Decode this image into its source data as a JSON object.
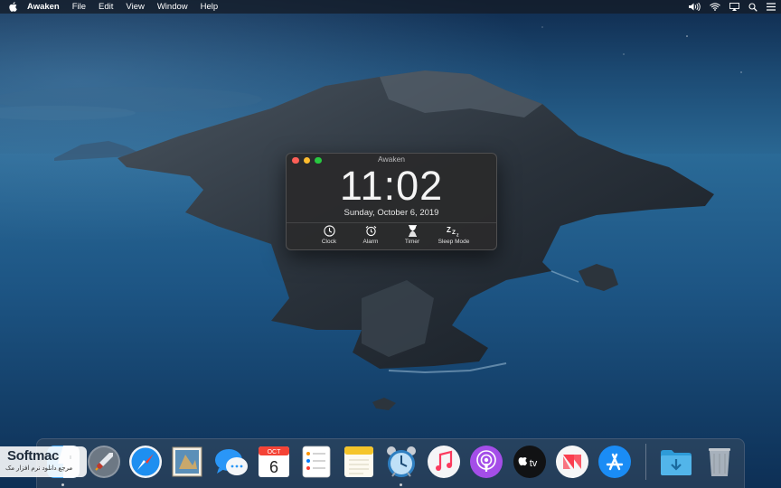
{
  "menubar": {
    "app_name": "Awaken",
    "menus": [
      "File",
      "Edit",
      "View",
      "Window",
      "Help"
    ],
    "status_icons": [
      "volume-icon",
      "wifi-icon",
      "airplay-icon",
      "search-icon",
      "menu-list-icon"
    ]
  },
  "awaken_window": {
    "title": "Awaken",
    "time": "11:02",
    "date": "Sunday, October 6, 2019",
    "tools": [
      {
        "label": "Clock",
        "icon": "clock-icon"
      },
      {
        "label": "Alarm",
        "icon": "alarm-icon"
      },
      {
        "label": "Timer",
        "icon": "timer-icon"
      },
      {
        "label": "Sleep Mode",
        "icon": "sleep-icon"
      }
    ]
  },
  "dock": {
    "apps": [
      "Finder",
      "Launchpad",
      "Safari",
      "Mail",
      "Messages",
      "Calendar",
      "Reminders",
      "Notes",
      "Awaken",
      "Music",
      "Podcasts",
      "TV",
      "News",
      "App Store",
      "Downloads",
      "Trash"
    ],
    "calendar": {
      "month": "OCT",
      "day": "6"
    },
    "tv_label": "tv"
  },
  "watermark": {
    "name": "Softmac",
    "subtitle": "مرجع دانلود نرم افزار مک"
  },
  "colors": {
    "close": "#fe5f57",
    "minimize": "#febc2e",
    "zoom": "#28c840",
    "window_bg": "#2a2a2c"
  }
}
